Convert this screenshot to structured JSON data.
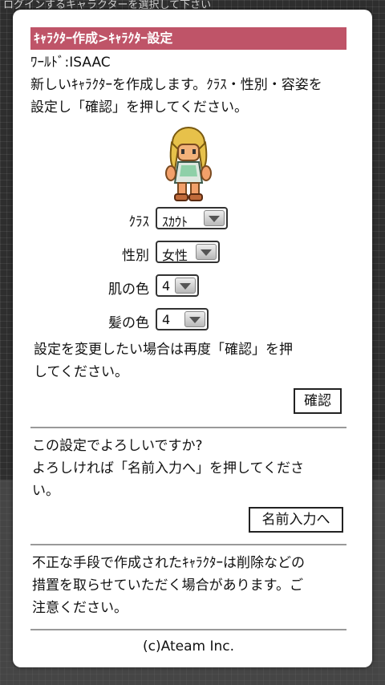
{
  "background": {
    "title": "ログインするキャラクターを選択して下さい"
  },
  "header": {
    "title": "ｷｬﾗｸﾀｰ作成>ｷｬﾗｸﾀｰ設定"
  },
  "world_line": "ﾜｰﾙﾄﾞ:ISAAC",
  "intro": {
    "line1": "新しいｷｬﾗｸﾀｰを作成します。ｸﾗｽ・性別・容姿を",
    "line2": "設定し「確認」を押してください。"
  },
  "form": {
    "class": {
      "label": "ｸﾗｽ",
      "value": "ｽｶｳﾄ"
    },
    "gender": {
      "label": "性別",
      "value": "女性"
    },
    "skin": {
      "label": "肌の色",
      "value": "4"
    },
    "hair": {
      "label": "髪の色",
      "value": "4"
    }
  },
  "change_note": {
    "line1": "設定を変更したい場合は再度「確認」を押",
    "line2": "してください。"
  },
  "confirm_button": "確認",
  "confirm_q": {
    "line1": "この設定でよろしいですか?",
    "line2": "よろしければ「名前入力へ」を押してくださ",
    "line3": "い。"
  },
  "name_button": "名前入力へ",
  "warning": {
    "line1": "不正な手段で作成されたｷｬﾗｸﾀｰは削除などの",
    "line2": "措置を取らせていただく場合があります。ご",
    "line3": "注意ください。"
  },
  "footer": "(c)Ateam Inc.",
  "colors": {
    "header_bg": "#bf5468",
    "card_bg": "#ffffff"
  },
  "icons": {
    "character": "character-sprite",
    "dropdown": "dropdown-arrow-icon"
  }
}
